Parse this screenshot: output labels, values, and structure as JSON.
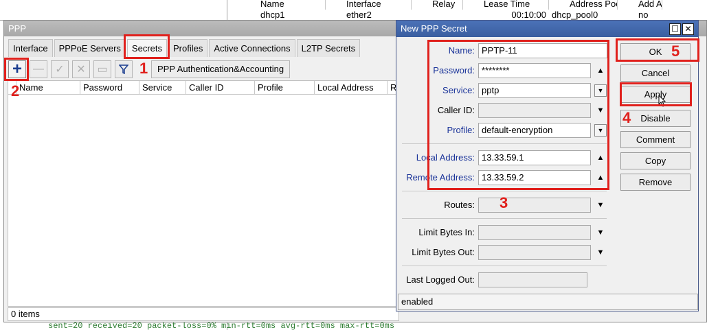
{
  "background": {
    "dhcp_columns": [
      "Name",
      "Interface",
      "Relay",
      "Lease Time",
      "Address Pool",
      "Add AR..."
    ],
    "dhcp_row": [
      "dhcp1",
      "ether2",
      "",
      "00:10:00",
      "dhcp_pool0",
      "no"
    ],
    "ping_output": "sent=20 received=20 packet-loss=0% min-rtt=0ms avg-rtt=0ms max-rtt=0ms"
  },
  "ppp": {
    "title": "PPP",
    "tabs": [
      "Interface",
      "PPPoE Servers",
      "Secrets",
      "Profiles",
      "Active Connections",
      "L2TP Secrets"
    ],
    "active_tab": "Secrets",
    "toolbar": {
      "add": "+",
      "remove": "—",
      "enable": "✓",
      "disable": "✕",
      "comment": "▭",
      "filter": "▽",
      "auth_button": "PPP Authentication&Accounting"
    },
    "columns": [
      "Name",
      "Password",
      "Service",
      "Caller ID",
      "Profile",
      "Local Address",
      "Re"
    ],
    "status": "0 items"
  },
  "dialog": {
    "title": "New PPP Secret",
    "fields": {
      "name_label": "Name:",
      "name_value": "PPTP-11",
      "password_label": "Password:",
      "password_value": "********",
      "service_label": "Service:",
      "service_value": "pptp",
      "caller_label": "Caller ID:",
      "caller_value": "",
      "profile_label": "Profile:",
      "profile_value": "default-encryption",
      "local_label": "Local Address:",
      "local_value": "13.33.59.1",
      "remote_label": "Remote Address:",
      "remote_value": "13.33.59.2",
      "routes_label": "Routes:",
      "routes_value": "",
      "limit_in_label": "Limit Bytes In:",
      "limit_in_value": "",
      "limit_out_label": "Limit Bytes Out:",
      "limit_out_value": "",
      "last_logged_label": "Last Logged Out:",
      "last_logged_value": ""
    },
    "buttons": [
      "OK",
      "Cancel",
      "Apply",
      "Disable",
      "Comment",
      "Copy",
      "Remove"
    ],
    "status": "enabled"
  },
  "annotations": [
    "1",
    "2",
    "3",
    "4",
    "5"
  ],
  "colors": {
    "annotation_red": "#e0201c",
    "dialog_title": "#3a5ea0",
    "field_label_blue": "#1a3399"
  }
}
